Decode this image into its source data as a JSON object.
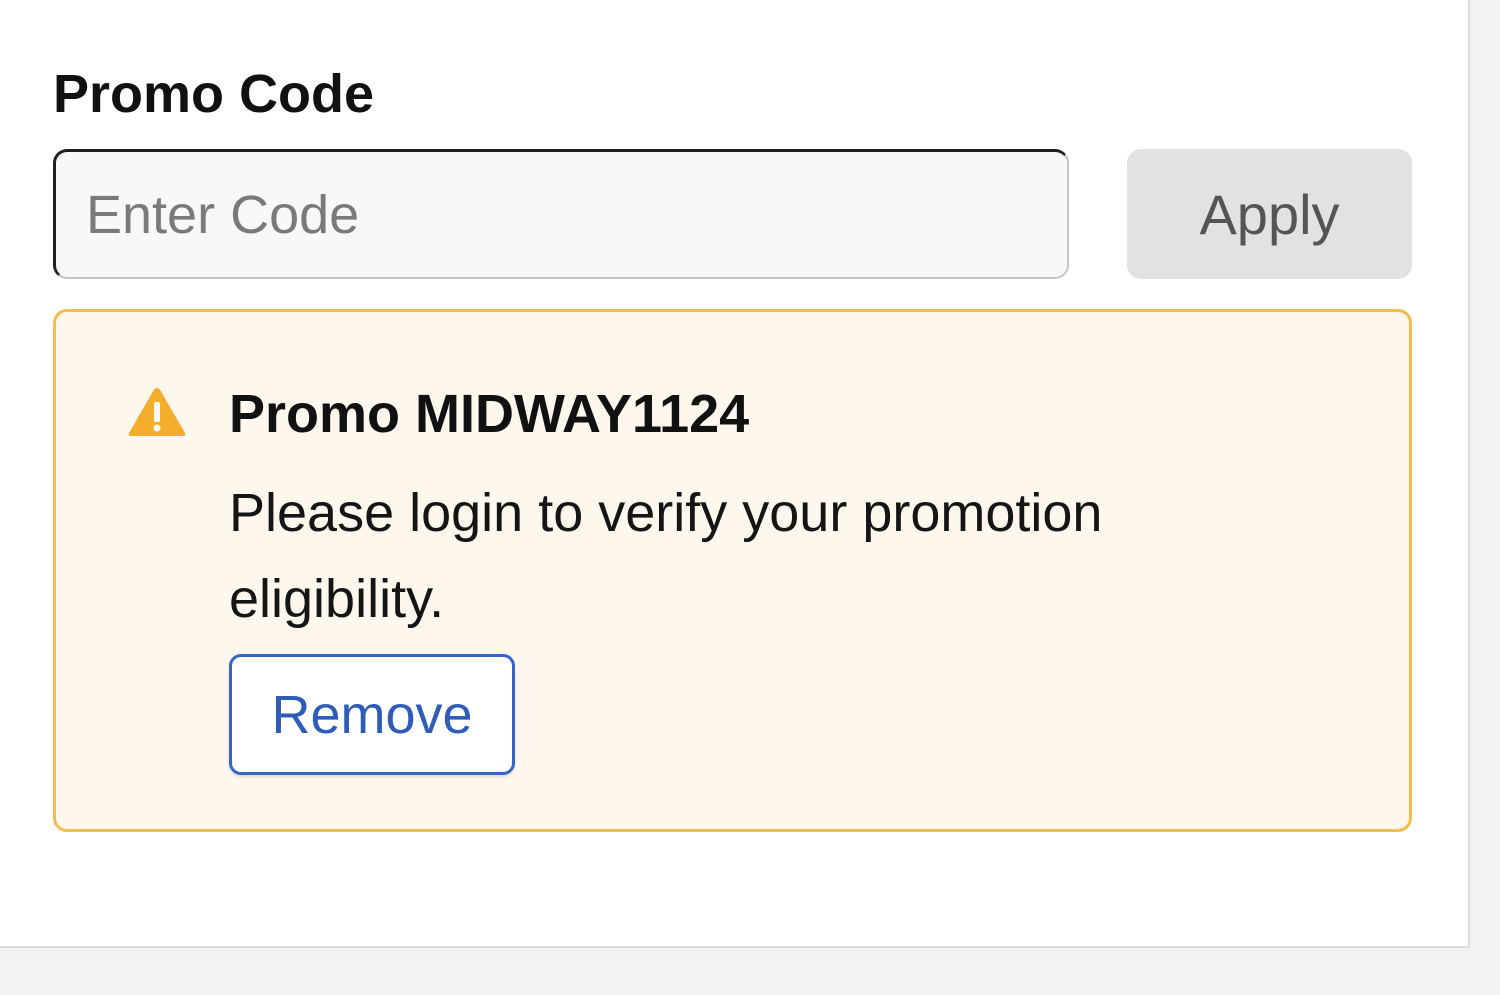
{
  "promo": {
    "title": "Promo Code",
    "input_placeholder": "Enter Code",
    "input_value": "",
    "apply_label": "Apply"
  },
  "alert": {
    "icon": "warning-icon",
    "title": "Promo MIDWAY1124",
    "message": "Please login to verify your promotion eligibility.",
    "remove_label": "Remove"
  },
  "colors": {
    "page_background": "#f2f2f2",
    "panel_background": "#ffffff",
    "alert_border": "#f3bc4e",
    "alert_background": "#fdf7ed",
    "warning_icon": "#f5ad2c",
    "link_blue": "#2e5cb8",
    "apply_background": "#e2e2e2"
  }
}
